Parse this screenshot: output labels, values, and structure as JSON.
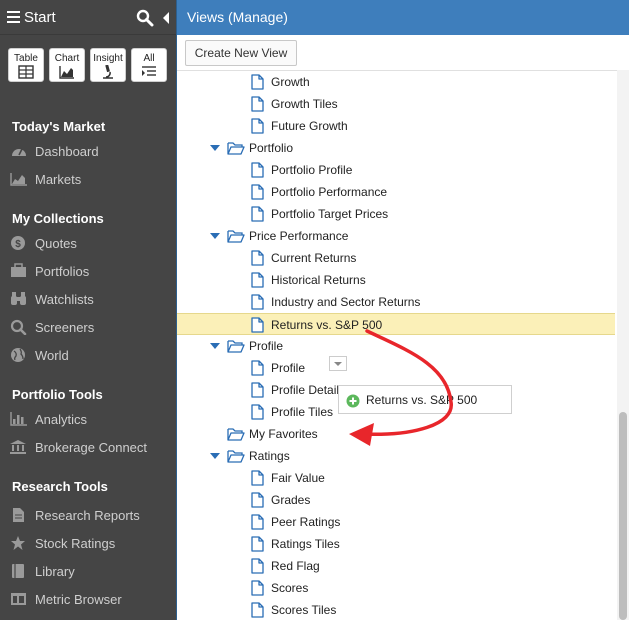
{
  "sidebar": {
    "title": "Start",
    "quick_buttons": [
      {
        "label": "Table",
        "icon": "table-icon"
      },
      {
        "label": "Chart",
        "icon": "chart-icon"
      },
      {
        "label": "Insight",
        "icon": "microscope-icon"
      },
      {
        "label": "All",
        "icon": "list-icon"
      }
    ],
    "sections": [
      {
        "title": "Today's Market",
        "items": [
          {
            "label": "Dashboard",
            "icon": "dashboard-icon"
          },
          {
            "label": "Markets",
            "icon": "area-chart-icon"
          }
        ]
      },
      {
        "title": "My Collections",
        "items": [
          {
            "label": "Quotes",
            "icon": "dollar-icon"
          },
          {
            "label": "Portfolios",
            "icon": "portfolio-icon"
          },
          {
            "label": "Watchlists",
            "icon": "binoculars-icon"
          },
          {
            "label": "Screeners",
            "icon": "search-icon"
          },
          {
            "label": "World",
            "icon": "globe-icon"
          }
        ]
      },
      {
        "title": "Portfolio Tools",
        "items": [
          {
            "label": "Analytics",
            "icon": "bar-chart-icon"
          },
          {
            "label": "Brokerage Connect",
            "icon": "bank-icon"
          }
        ]
      },
      {
        "title": "Research Tools",
        "items": [
          {
            "label": "Research Reports",
            "icon": "document-icon"
          },
          {
            "label": "Stock Ratings",
            "icon": "star-icon"
          },
          {
            "label": "Library",
            "icon": "book-icon"
          },
          {
            "label": "Metric Browser",
            "icon": "columns-icon"
          }
        ]
      }
    ]
  },
  "main": {
    "title": "Views (Manage)",
    "create_button": "Create New View",
    "tree": [
      {
        "type": "child",
        "label": "Growth"
      },
      {
        "type": "child",
        "label": "Growth Tiles"
      },
      {
        "type": "child",
        "label": "Future Growth"
      },
      {
        "type": "folder",
        "label": "Portfolio",
        "expanded": true
      },
      {
        "type": "child",
        "label": "Portfolio Profile"
      },
      {
        "type": "child",
        "label": "Portfolio Performance"
      },
      {
        "type": "child",
        "label": "Portfolio Target Prices"
      },
      {
        "type": "folder",
        "label": "Price Performance",
        "expanded": true
      },
      {
        "type": "child",
        "label": "Current Returns"
      },
      {
        "type": "child",
        "label": "Historical Returns"
      },
      {
        "type": "child",
        "label": "Industry and Sector Returns"
      },
      {
        "type": "child",
        "label": "Returns vs. S&P 500",
        "selected": true
      },
      {
        "type": "folder",
        "label": "Profile",
        "expanded": true
      },
      {
        "type": "child",
        "label": "Profile"
      },
      {
        "type": "child",
        "label": "Profile Detail"
      },
      {
        "type": "child",
        "label": "Profile Tiles"
      },
      {
        "type": "folder",
        "label": "My Favorites",
        "expanded": false,
        "dropdown": true
      },
      {
        "type": "folder",
        "label": "Ratings",
        "expanded": true
      },
      {
        "type": "child",
        "label": "Fair Value"
      },
      {
        "type": "child",
        "label": "Grades"
      },
      {
        "type": "child",
        "label": "Peer Ratings"
      },
      {
        "type": "child",
        "label": "Ratings Tiles"
      },
      {
        "type": "child",
        "label": "Red Flag"
      },
      {
        "type": "child",
        "label": "Scores"
      },
      {
        "type": "child",
        "label": "Scores Tiles"
      }
    ],
    "drag_ghost": {
      "label": "Returns vs. S&P 500",
      "icon": "add-icon"
    }
  },
  "colors": {
    "sidebar_bg": "#454545",
    "header_blue": "#3e7ebc",
    "selection": "#fbf0b8",
    "arrow": "#e8262b",
    "icon_blue": "#2a6db5",
    "add_green": "#5cb85c"
  }
}
